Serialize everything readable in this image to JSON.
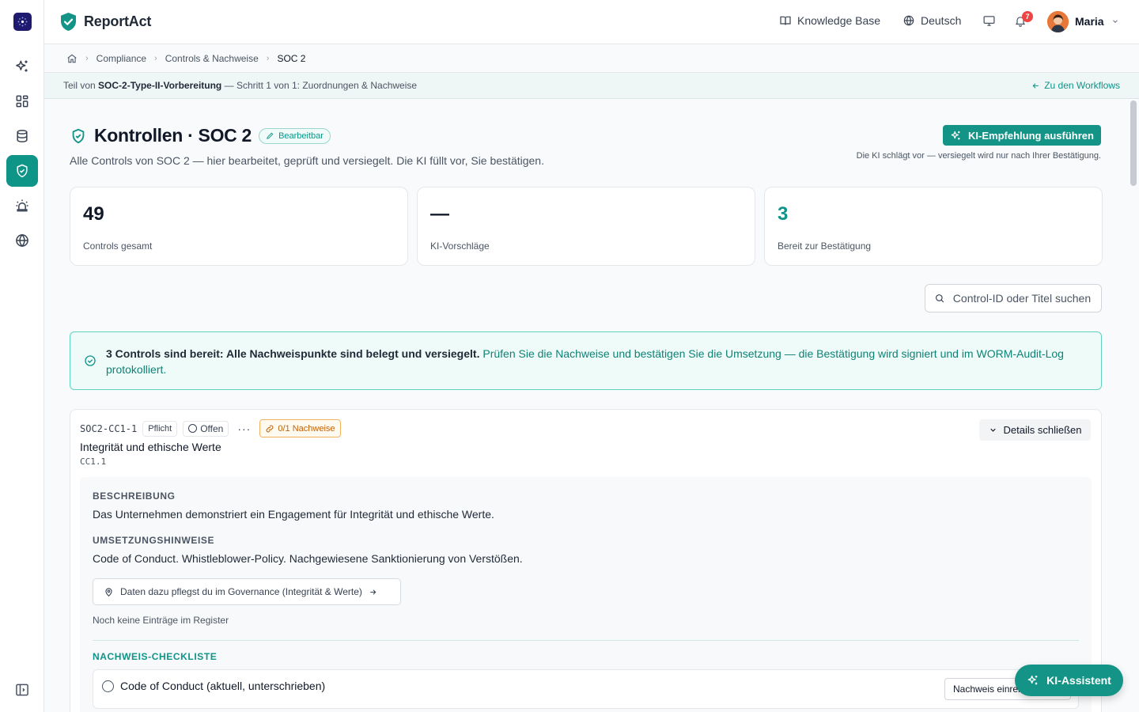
{
  "app": {
    "name": "ReportAct"
  },
  "topbar": {
    "knowledge_base": "Knowledge Base",
    "language": "Deutsch",
    "notification_count": "7",
    "user_name": "Maria"
  },
  "breadcrumb": [
    "Compliance",
    "Controls & Nachweise",
    "SOC 2"
  ],
  "workflow": {
    "prefix": "Teil von",
    "name": "SOC-2-Type-II-Vorbereitung",
    "step": "— Schritt 1 von 1: Zuordnungen & Nachweise",
    "back_label": "Zu den Workflows"
  },
  "page": {
    "title": "Kontrollen · SOC 2",
    "badge": "Bearbeitbar",
    "subtitle": "Alle Controls von SOC 2 — hier bearbeitet, geprüft und versiegelt. Die KI füllt vor, Sie bestätigen.",
    "ai_button": "KI-Empfehlung ausführen",
    "ai_note": "Die KI schlägt vor — versiegelt wird nur nach Ihrer Bestätigung."
  },
  "stats": [
    {
      "value": "49",
      "label": "Controls gesamt",
      "accent": false
    },
    {
      "value": "—",
      "label": "KI-Vorschläge",
      "accent": false
    },
    {
      "value": "3",
      "label": "Bereit zur Bestätigung",
      "accent": true
    }
  ],
  "search": {
    "placeholder": "Control-ID oder Titel suchen"
  },
  "banner": {
    "bold": "3 Controls sind bereit: Alle Nachweispunkte sind belegt und versiegelt.",
    "text": " Prüfen Sie die Nachweise und bestätigen Sie die Umsetzung — die Bestätigung wird signiert und im WORM-Audit-Log protokolliert."
  },
  "control": {
    "id": "SOC2-CC1-1",
    "tag": "Pflicht",
    "status": "Offen",
    "evidence": "0/1 Nachweise",
    "title": "Integrität und ethische Werte",
    "ref": "CC1.1",
    "close_label": "Details schließen",
    "description_label": "BESCHREIBUNG",
    "description": "Das Unternehmen demonstriert ein Engagement für Integrität und ethische Werte.",
    "hints_label": "UMSETZUNGSHINWEISE",
    "hints": "Code of Conduct. Whistleblower-Policy. Nachgewiesene Sanktionierung von Verstößen.",
    "governance_link": "Daten dazu pflegst du im Governance (Integrität & Werte)",
    "empty_note": "Noch keine Einträge im Register",
    "checklist_label": "NACHWEIS-CHECKLISTE",
    "checklist": [
      {
        "text": "Code of Conduct (aktuell, unterschrieben)",
        "button": "Nachweis einreichen"
      }
    ]
  },
  "assistant": {
    "label": "KI-Assistent"
  },
  "colors": {
    "accent": "#149486",
    "brand_dark": "#1e1b6e",
    "warning": "#c2620a"
  }
}
